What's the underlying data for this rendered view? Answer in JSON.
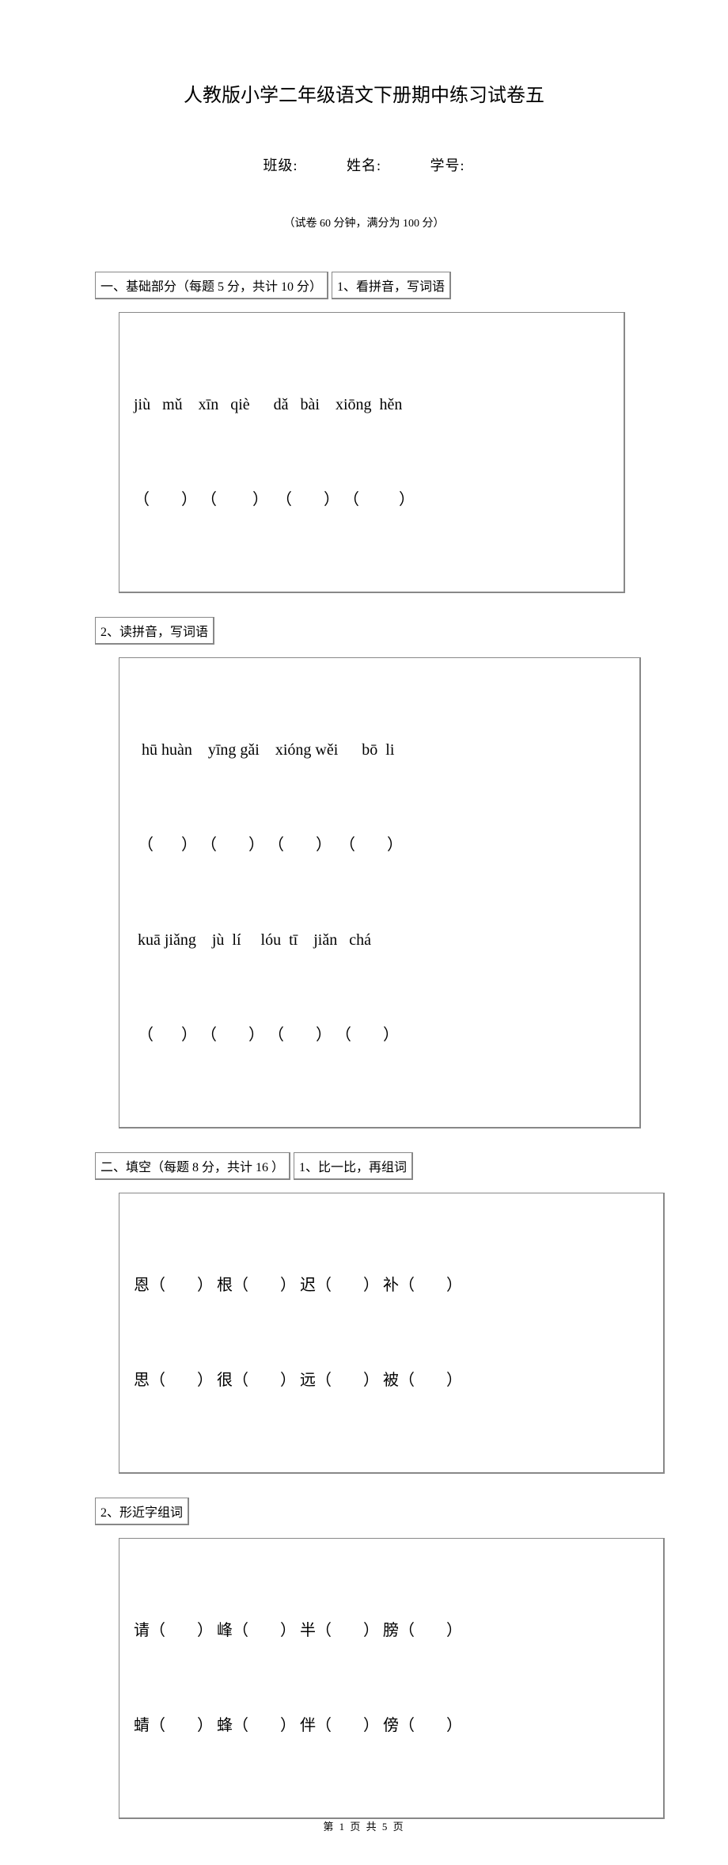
{
  "title": "人教版小学二年级语文下册期中练习试卷五",
  "meta": {
    "class_label": "班级:",
    "name_label": "姓名:",
    "id_label": "学号:"
  },
  "exam_info": "（试卷 60 分钟，满分为    100 分）",
  "sections": {
    "s1": {
      "header": "一、基础部分（每题 5 分，共计 10 分）",
      "q1": {
        "label": "1、看拼音，写词语",
        "row1": "jiù   mǔ    xīn   qiè      dǎ   bài    xiōng  hěn",
        "row2": "（        ） （         ）  （        ） （          ）"
      },
      "q2": {
        "label": "2、读拼音，写词语",
        "row1": "  hū huàn    yīng gǎi    xióng wěi      bō  li",
        "row2": " （       ） （        ） （        ）  （        ）",
        "row3": " kuā jiǎng    jù  lí     lóu  tī    jiǎn   chá",
        "row4": " （       ） （        ） （        ） （        ）"
      }
    },
    "s2": {
      "header": "二、填空（每题 8 分，共计 16 ）",
      "q1": {
        "label": "1、比一比，再组词",
        "row1": "恩（        ） 根（        ） 迟（        ） 补（        ）",
        "row2": "思（        ） 很（        ） 远（        ） 被（        ）"
      },
      "q2": {
        "label": "2、形近字组词",
        "row1": "请（        ） 峰（        ） 半（        ） 膀（        ）",
        "row2": "蜻（        ） 蜂（        ） 伴（        ） 傍（        ）"
      }
    }
  },
  "footer": "第    1 页 共 5 页"
}
